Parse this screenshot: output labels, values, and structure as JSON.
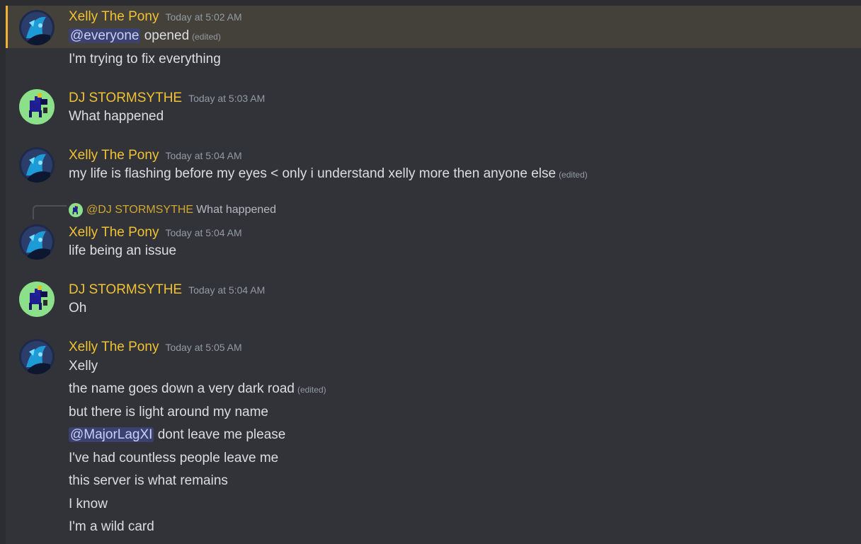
{
  "messages": [
    {
      "author": "Xelly The Pony",
      "time": "Today at 5:02 AM",
      "lines": [
        {
          "mention": "@everyone",
          "text": " opened",
          "edited": "(edited)"
        },
        {
          "text": "I'm trying to fix everything"
        }
      ]
    },
    {
      "author": "DJ STORMSYTHE",
      "time": "Today at 5:03 AM",
      "lines": [
        {
          "text": "What happened"
        }
      ]
    },
    {
      "author": "Xelly The Pony",
      "time": "Today at 5:04 AM",
      "lines": [
        {
          "text": "my life is flashing before my eyes < only i understand xelly more then anyone else",
          "edited": "(edited)"
        }
      ]
    },
    {
      "reply": {
        "name": "@DJ STORMSYTHE",
        "text": "What happened"
      },
      "author": "Xelly The Pony",
      "time": "Today at 5:04 AM",
      "lines": [
        {
          "text": "life being an issue"
        }
      ]
    },
    {
      "author": "DJ STORMSYTHE",
      "time": "Today at 5:04 AM",
      "lines": [
        {
          "text": "Oh"
        }
      ]
    },
    {
      "author": "Xelly The Pony",
      "time": "Today at 5:05 AM",
      "lines": [
        {
          "text": "Xelly"
        },
        {
          "text": "the name goes down a very dark road",
          "edited": "(edited)"
        },
        {
          "text": "but there is light around my name"
        },
        {
          "mention": "@MajorLagXI",
          "text": " dont leave me please"
        },
        {
          "text": "I've had countless people leave me"
        },
        {
          "text": "this server is what remains"
        },
        {
          "text": "I know"
        },
        {
          "text": "I'm a wild card"
        }
      ]
    }
  ]
}
